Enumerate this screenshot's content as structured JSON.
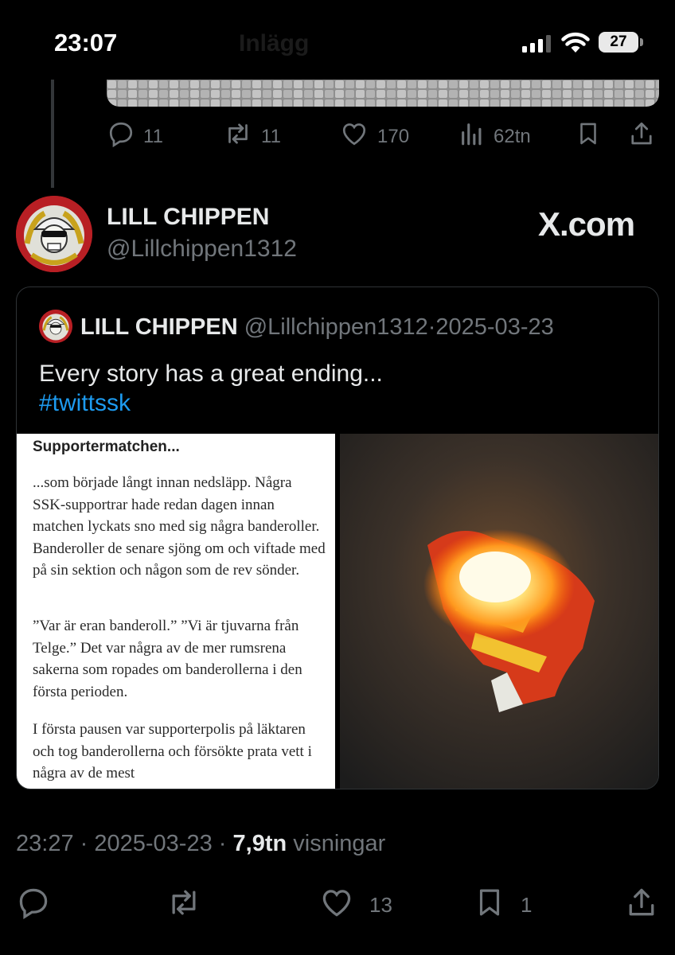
{
  "status_bar": {
    "time": "23:07",
    "battery": "27",
    "ghost_title": "Inlägg"
  },
  "previous_post": {
    "actions": {
      "replies": "11",
      "reposts": "11",
      "likes": "170",
      "views": "62tn"
    }
  },
  "post": {
    "author_name": "LILL CHIPPEN",
    "author_handle": "@Lillchippen1312",
    "watermark": "X.com"
  },
  "quoted_post": {
    "author_name": "LILL CHIPPEN",
    "author_handle": "@Lillchippen1312",
    "separator": "·",
    "date": "2025-03-23",
    "text": "Every story has a great ending...",
    "hashtag": "#twittssk",
    "article": {
      "title": "Supportermatchen...",
      "paragraphs": [
        "...som började långt innan nedsläpp. Några SSK-supportrar hade redan dagen innan matchen lyckats sno med sig några banderoller. Banderoller de senare sjöng om och viftade med på sin sektion och någon som de rev sönder.",
        "”Var är eran banderoll.” ”Vi är tjuvarna från Telge.” Det var några av de mer rumsrena sakerna som ropades om banderollerna i den första perioden.",
        "I första pausen var supporterpolis på läktaren och tog banderollerna och försökte prata vett i några av de mest"
      ]
    }
  },
  "footer": {
    "time": "23:27",
    "separator": "·",
    "date": "2025-03-23",
    "views_count": "7,9tn",
    "views_label": "visningar"
  },
  "bottom_actions": {
    "likes": "13",
    "bookmarks": "1"
  },
  "colors": {
    "background": "#000000",
    "text": "#e7e9ea",
    "muted": "#71767b",
    "link": "#1d9bf0",
    "border": "#2f3336"
  }
}
